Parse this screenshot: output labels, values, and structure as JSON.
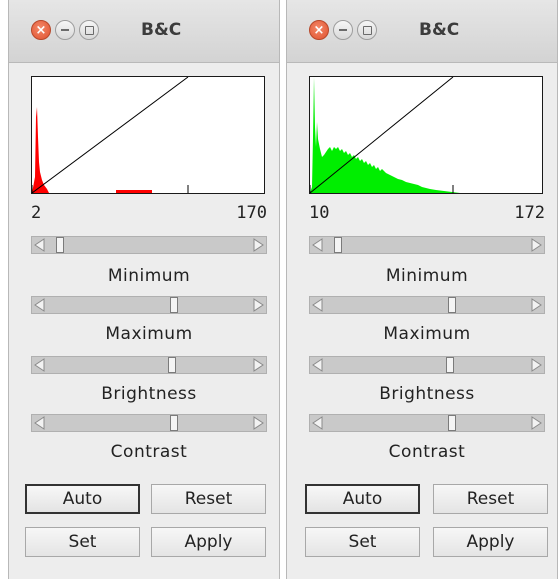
{
  "windows": [
    {
      "title": "B&C",
      "range_min": "2",
      "range_max": "170",
      "histogram_color": "#ff0000",
      "sliders": [
        {
          "label": "Minimum",
          "value": 0.04
        },
        {
          "label": "Maximum",
          "value": 0.63
        },
        {
          "label": "Brightness",
          "value": 0.62
        },
        {
          "label": "Contrast",
          "value": 0.63
        }
      ],
      "buttons": {
        "auto": "Auto",
        "reset": "Reset",
        "set": "Set",
        "apply": "Apply"
      }
    },
    {
      "title": "B&C",
      "range_min": "10",
      "range_max": "172",
      "histogram_color": "#00ee00",
      "sliders": [
        {
          "label": "Minimum",
          "value": 0.04
        },
        {
          "label": "Maximum",
          "value": 0.63
        },
        {
          "label": "Brightness",
          "value": 0.62
        },
        {
          "label": "Contrast",
          "value": 0.63
        }
      ],
      "buttons": {
        "auto": "Auto",
        "reset": "Reset",
        "set": "Set",
        "apply": "Apply"
      }
    }
  ]
}
